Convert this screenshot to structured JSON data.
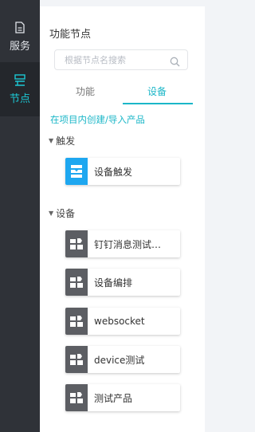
{
  "rail": {
    "items": [
      {
        "label": "服务",
        "icon": "document-icon"
      },
      {
        "label": "节点",
        "icon": "nodes-icon",
        "active": true
      }
    ]
  },
  "panel": {
    "title": "功能节点",
    "search": {
      "placeholder": "根据节点名搜索"
    },
    "tabs": [
      {
        "label": "功能"
      },
      {
        "label": "设备",
        "active": true
      }
    ],
    "create_link": "在项目内创建/导入产品",
    "sections": [
      {
        "title": "触发",
        "nodes": [
          {
            "label": "设备触发",
            "icon": "trigger-icon",
            "color": "#1ea7f0"
          }
        ]
      },
      {
        "title": "设备",
        "nodes": [
          {
            "label": "钉钉消息测试…",
            "icon": "device-icon"
          },
          {
            "label": "设备编排",
            "icon": "device-icon"
          },
          {
            "label": "websocket",
            "icon": "device-icon"
          },
          {
            "label": "device测试",
            "icon": "device-icon"
          },
          {
            "label": "测试产品",
            "icon": "device-icon"
          }
        ]
      }
    ]
  },
  "colors": {
    "accent": "#1cb7c8",
    "rail_bg": "#2f3238",
    "trigger_blue": "#1ea7f0",
    "device_gray": "#5c5e63"
  }
}
